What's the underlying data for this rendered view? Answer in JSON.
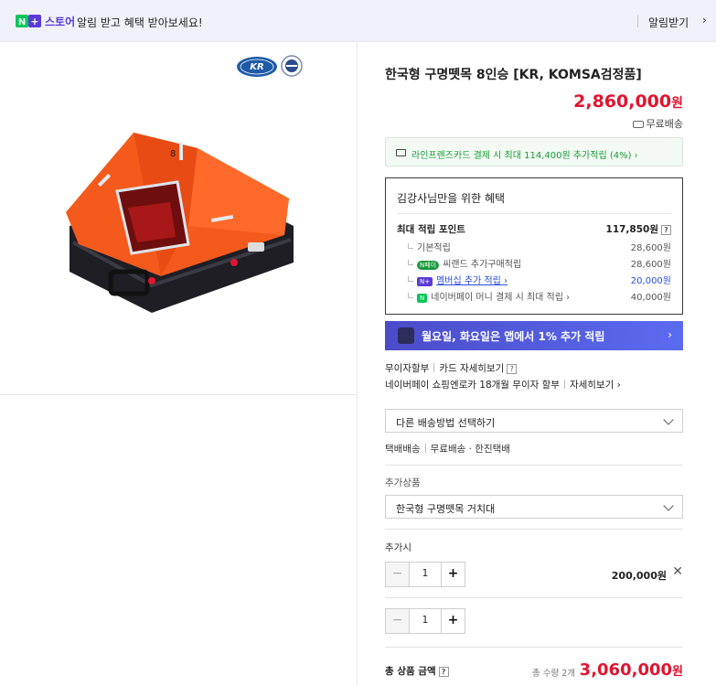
{
  "topbar": {
    "badge": "N+",
    "store_label": "스토어",
    "message": "알림 받고 혜택 받아보세요!",
    "alarm_label": "알림받기",
    "alarm_chevron": "›"
  },
  "logos": {
    "kr_text": "KR"
  },
  "product": {
    "title": "한국형 구명뗏목 8인승 [KR, KOMSA검정품]",
    "price": "2,860,000",
    "price_unit": "원",
    "shipping": "무료배송"
  },
  "card_promo": {
    "text": "라인프렌즈카드 결제 시 최대 114,400원 추가적립 (4%) ›"
  },
  "benefit": {
    "title": "김강사님만을 위한 혜택",
    "max_label": "최대 적립 포인트",
    "max_value": "117,850원",
    "rows": [
      {
        "label": "기본적립",
        "value": "28,600원"
      },
      {
        "badge": "N페이",
        "label": "씨랜드 추가구매적립",
        "value": "28,600원"
      },
      {
        "badge": "N+",
        "label": "멤버십 추가 적립 ›",
        "value": "20,000원"
      },
      {
        "badge": "N",
        "label": "네이버페이 머니 결제 시 최대 적립 ›",
        "value": "40,000원"
      }
    ]
  },
  "naver_banner": {
    "text": "월요일, 화요일은 앱에서 1% 추가 적립",
    "chevron": "›"
  },
  "installment": {
    "label1": "무이자할부",
    "link1": "카드 자세히보기",
    "label2": "네이버페이 쇼핑엔로카 18개월 무이자 할부",
    "link2": "자세히보기 ›"
  },
  "shipping_select": {
    "value": "다른 배송방법 선택하기"
  },
  "ship_info": {
    "a": "택배배송",
    "b": "무료배송 · 한진택배"
  },
  "addon": {
    "section_label": "추가상품",
    "select_value": "한국형 구명뗏목 거치대",
    "item_label": "추가시",
    "qty": "1",
    "price": "200,000원",
    "remove": "✕"
  },
  "main_qty": {
    "qty": "1"
  },
  "stepper_minus": "−",
  "stepper_plus": "+",
  "total": {
    "label": "총 상품 금액",
    "count": "총 수량 2개",
    "price": "3,060,000",
    "unit": "원"
  },
  "colors": {
    "accent": "#e0152f",
    "naver_purple": "#5b3bd6",
    "green": "#1a9a3a",
    "link_blue": "#2b4fd8",
    "banner_blue": "#5567e8"
  },
  "icons": [
    "naver-plus-icon",
    "chevron-right-icon",
    "truck-icon",
    "card-icon",
    "question-icon",
    "chevron-down-icon",
    "close-icon"
  ]
}
